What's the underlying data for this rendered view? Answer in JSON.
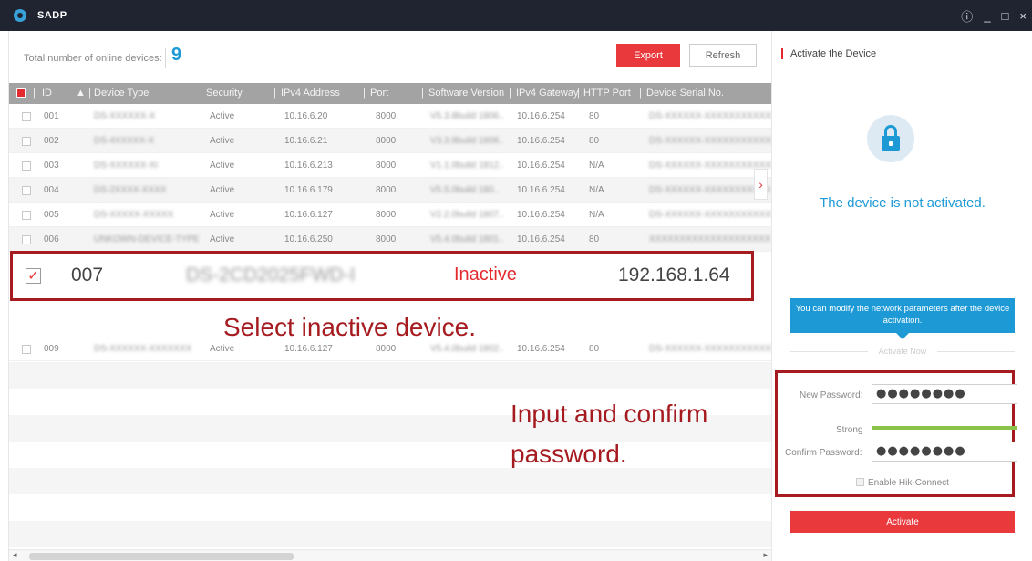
{
  "app": {
    "title": "SADP"
  },
  "window_controls": {
    "info": "ⓘ",
    "minimize": "_",
    "maximize": "□",
    "close": "×"
  },
  "toolbar": {
    "online_label": "Total number of online devices:",
    "online_count": "9",
    "export_label": "Export",
    "refresh_label": "Refresh"
  },
  "table": {
    "columns": [
      "ID",
      "Device Type",
      "Security",
      "IPv4 Address",
      "Port",
      "Software Version",
      "IPv4 Gateway",
      "HTTP Port",
      "Device Serial No."
    ],
    "rows": [
      {
        "id": "001",
        "type": "DS-XXXXXX-X",
        "security": "Active",
        "ip": "10.16.6.20",
        "port": "8000",
        "sw": "V5.3.8build 1806..",
        "gateway": "10.16.6.254",
        "http": "80",
        "serial": "DS-XXXXXX-XXXXXXXXXXXXX"
      },
      {
        "id": "002",
        "type": "DS-4XXXXX-X",
        "security": "Active",
        "ip": "10.16.6.21",
        "port": "8000",
        "sw": "V3.3.8build 1808..",
        "gateway": "10.16.6.254",
        "http": "80",
        "serial": "DS-XXXXXX-XXXXXXXXXXXXX"
      },
      {
        "id": "003",
        "type": "DS-XXXXXX-XI",
        "security": "Active",
        "ip": "10.16.6.213",
        "port": "8000",
        "sw": "V1.1.0build 1812..",
        "gateway": "10.16.6.254",
        "http": "N/A",
        "serial": "DS-XXXXXX-XXXXXXXXXXXX"
      },
      {
        "id": "004",
        "type": "DS-2XXXX-XXXX",
        "security": "Active",
        "ip": "10.16.6.179",
        "port": "8000",
        "sw": "V5.5.0build 180..",
        "gateway": "10.16.6.254",
        "http": "N/A",
        "serial": "DS-XXXXXX-XXXXXXXXXXX"
      },
      {
        "id": "005",
        "type": "DS-XXXXX-XXXXX",
        "security": "Active",
        "ip": "10.16.6.127",
        "port": "8000",
        "sw": "V2.2.0build 1807..",
        "gateway": "10.16.6.254",
        "http": "N/A",
        "serial": "DS-XXXXXX-XXXXXXXXXXXX"
      },
      {
        "id": "006",
        "type": "UNKOWN-DEVICE-TYPE",
        "security": "Active",
        "ip": "10.16.6.250",
        "port": "8000",
        "sw": "V5.4.0build 1801..",
        "gateway": "10.16.6.254",
        "http": "80",
        "serial": "XXXXXXXXXXXXXXXXXXXX"
      },
      {
        "id": "009",
        "type": "DS-XXXXXX-XXXXXXX",
        "security": "Active",
        "ip": "10.16.6.127",
        "port": "8000",
        "sw": "V5.4.0build 1802..",
        "gateway": "10.16.6.254",
        "http": "80",
        "serial": "DS-XXXXXX-XXXXXXXXXXXX"
      }
    ]
  },
  "selected_device": {
    "id": "007",
    "type": "DS-2CD2025FWD-I",
    "status": "Inactive",
    "ip": "192.168.1.64"
  },
  "annotations": {
    "select": "Select inactive device.",
    "input_line1": "Input and confirm",
    "input_line2": "password."
  },
  "activation": {
    "title": "Activate the Device",
    "status": "The device is not activated.",
    "info": "You can modify the network parameters after the device activation.",
    "divider": "Activate Now",
    "new_password_label": "New Password:",
    "new_password_value": "●●●●●●●●",
    "strength_label": "Strong",
    "confirm_label": "Confirm Password:",
    "confirm_value": "●●●●●●●●",
    "hik_connect_label": "Enable Hik-Connect",
    "activate_button": "Activate"
  },
  "colors": {
    "accent_red": "#e9393d",
    "annotation_red": "#a51b20",
    "accent_blue": "#1d9ad6",
    "titlebar": "#1f2430",
    "strength_green": "#8bc34a"
  }
}
